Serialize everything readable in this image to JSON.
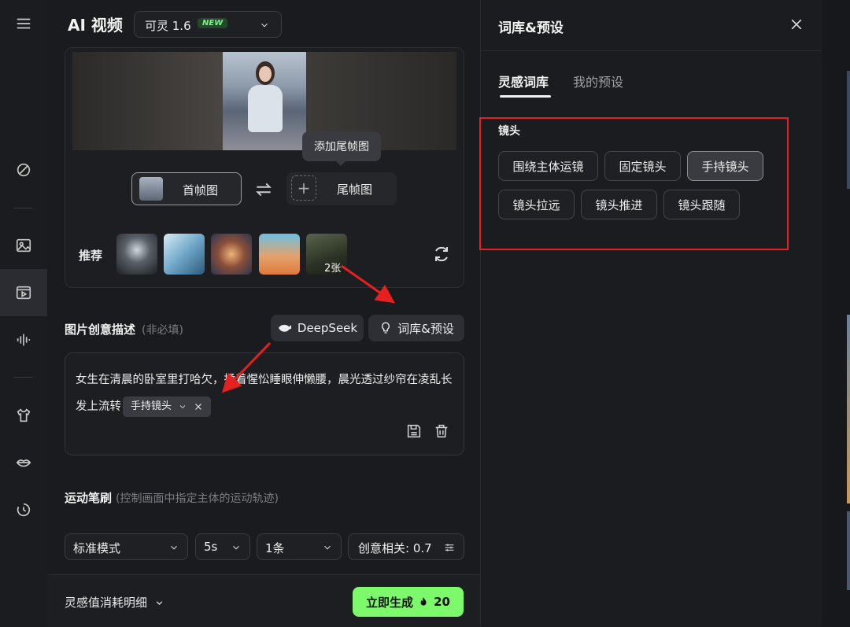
{
  "header": {
    "title": "AI 视频",
    "model": "可灵 1.6",
    "model_badge": "NEW"
  },
  "frames": {
    "tooltip": "添加尾帧图",
    "first_label": "首帧图",
    "last_label": "尾帧图",
    "recommend_label": "推荐",
    "recommend_more": "2张"
  },
  "description": {
    "title": "图片创意描述",
    "hint": "(非必填)",
    "deepseek_label": "DeepSeek",
    "preset_label": "词库&预设",
    "text": "女生在清晨的卧室里打哈欠，揉着惺忪睡眼伸懒腰，晨光透过纱帘在凌乱长发上流转",
    "tag": "手持镜头"
  },
  "motion_brush": {
    "title": "运动笔刷",
    "hint": "(控制画面中指定主体的运动轨迹)"
  },
  "settings": {
    "mode": "标准模式",
    "duration": "5s",
    "count": "1条",
    "creativity": "创意相关: 0.7"
  },
  "footer": {
    "cost_detail": "灵感值消耗明细",
    "generate_label": "立即生成",
    "generate_cost": "20"
  },
  "drawer": {
    "title": "词库&预设",
    "tabs": [
      "灵感词库",
      "我的预设"
    ],
    "category": "镜头",
    "chips": [
      "围绕主体运镜",
      "固定镜头",
      "手持镜头",
      "镜头拉远",
      "镜头推进",
      "镜头跟随"
    ],
    "selected_chip": "手持镜头"
  },
  "colors": {
    "accent_green": "#7cfa6c",
    "highlight_red": "#e5201f",
    "badge_green": "#7df28b"
  }
}
